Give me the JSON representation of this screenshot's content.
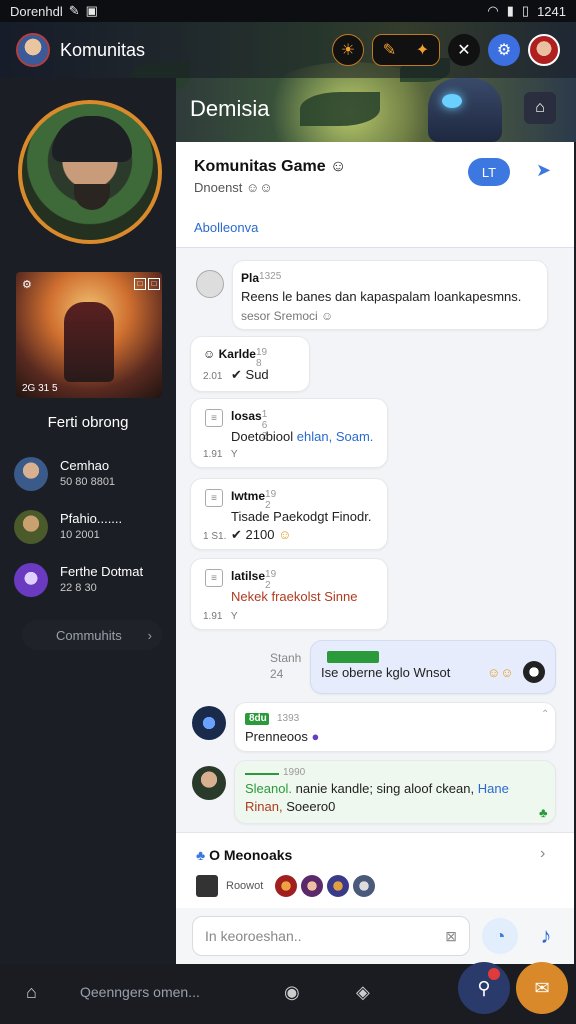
{
  "status": {
    "carrier": "Dorenhdl",
    "time": "1241"
  },
  "header": {
    "title": "Komunitas",
    "hero_label": "Demisia"
  },
  "sidebar": {
    "game_caption": "2G 31 5",
    "section_title": "Ferti obrong",
    "items": [
      {
        "name": "Cemhao",
        "sub": "50 80 8801"
      },
      {
        "name": "Pfahio.......",
        "sub": "10 2001"
      },
      {
        "name": "Ferthe Dotmat",
        "sub": "22 8 30"
      }
    ],
    "community_button": "Commuhits"
  },
  "panel": {
    "title": "Komunitas Game",
    "subtitle": "Dnoenst",
    "link": "Abolleonva",
    "badge": "LT"
  },
  "messages": [
    {
      "name": "Pla",
      "time": "1325",
      "text": "Reens le banes dan kapaspalam loankapesmns.",
      "sub": "sesor Sremoci"
    },
    {
      "name": "Karlde",
      "time": "19 8",
      "meta": "2.01",
      "text": "Sud"
    },
    {
      "name": "losas",
      "time": "1 6 2",
      "text_a": "Doetobiool ",
      "text_b": "ehlan, Soam.",
      "meta": "1.91",
      "tail": "Y"
    },
    {
      "name": "Iwtme",
      "time": "19 2",
      "text": "Tisade Paekodgt Finodr.",
      "meta": "1 S1.",
      "extra": "2100"
    },
    {
      "name": "latilse",
      "time": "19 2",
      "text": "Nekek fraekolst Sinne",
      "meta": "1.91",
      "tail": "Y"
    },
    {
      "name": "Stanh",
      "time": "24",
      "text": "Ise oberne kglo Wnsot"
    },
    {
      "name": "8du",
      "time": "1393",
      "text": "Prenneoos"
    },
    {
      "name": "",
      "time": "1990",
      "text_a": "Sleanol. ",
      "text_b": "nanie kandle; sing aloof ckean, ",
      "text_c": "Hane",
      "line2a": "Rinan, ",
      "line2b": "Soeero0"
    }
  ],
  "members": {
    "title": "O Meonoaks",
    "label": "Roowot"
  },
  "composer": {
    "placeholder": "In keoroeshan.."
  },
  "bottom": {
    "search": "Qeenngers omen..."
  }
}
